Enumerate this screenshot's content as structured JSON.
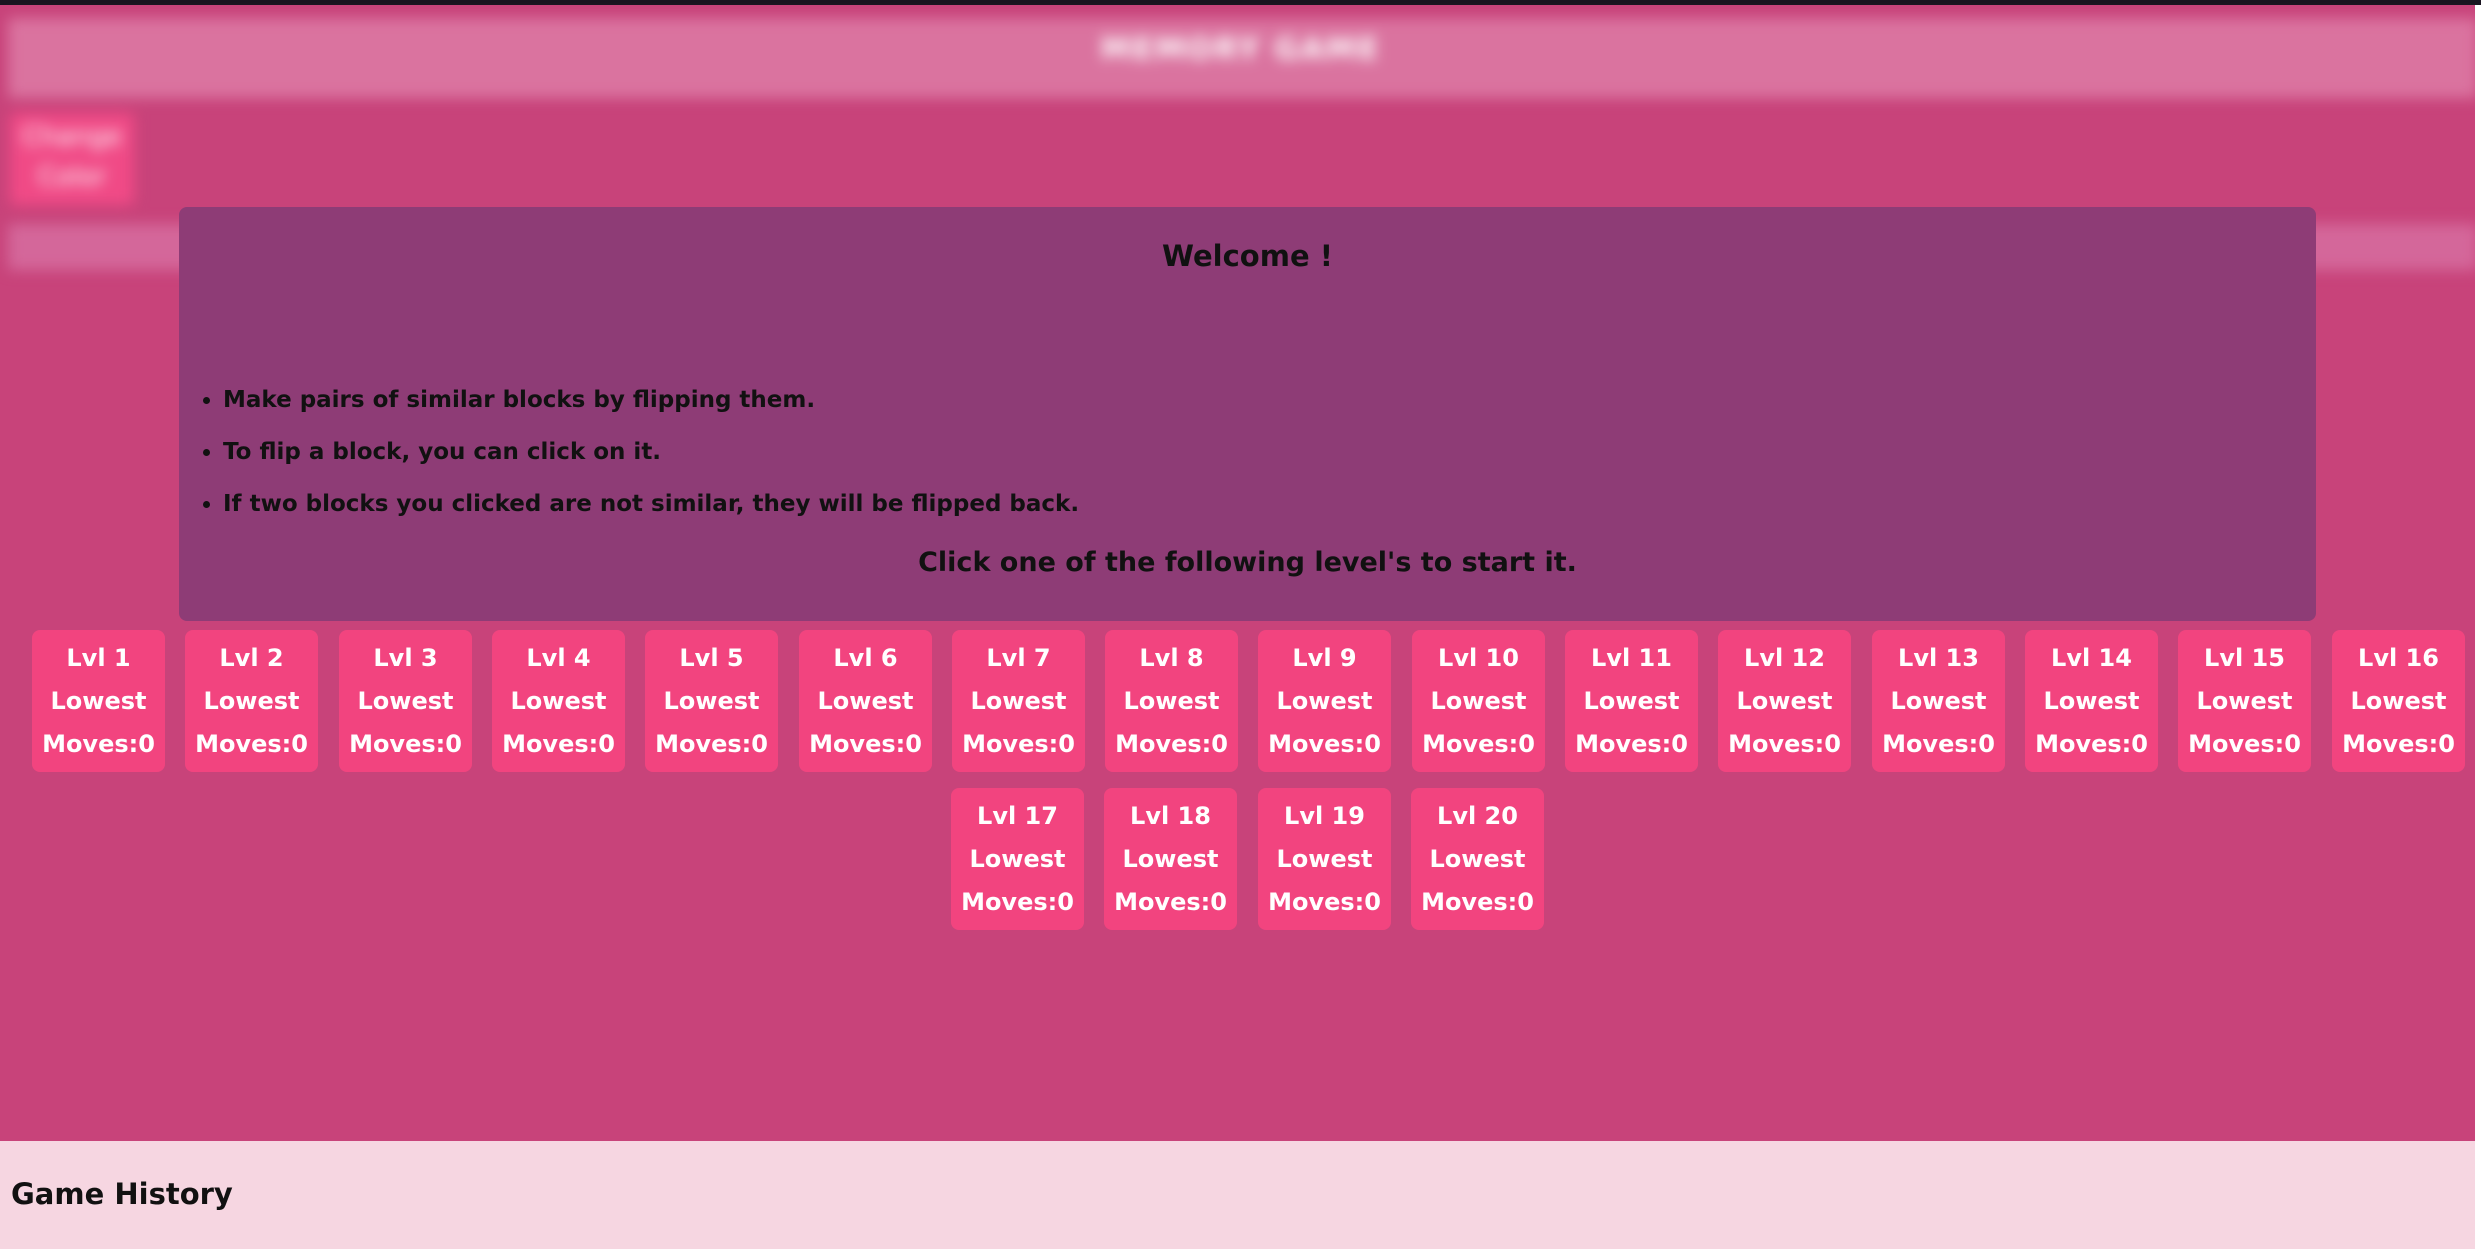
{
  "header": {
    "title": "MEMORY GAME",
    "color_button_label": "Change Color"
  },
  "modal": {
    "title": "Welcome !",
    "instructions": [
      "Make pairs of similar blocks by flipping them.",
      "To flip a block, you can click on it.",
      "If two blocks you clicked are not similar, they will be flipped back."
    ],
    "start_text": "Click one of the following level's to start it."
  },
  "levels": [
    {
      "label": "Lvl 1",
      "lowest": "Lowest",
      "moves": "Moves:0"
    },
    {
      "label": "Lvl 2",
      "lowest": "Lowest",
      "moves": "Moves:0"
    },
    {
      "label": "Lvl 3",
      "lowest": "Lowest",
      "moves": "Moves:0"
    },
    {
      "label": "Lvl 4",
      "lowest": "Lowest",
      "moves": "Moves:0"
    },
    {
      "label": "Lvl 5",
      "lowest": "Lowest",
      "moves": "Moves:0"
    },
    {
      "label": "Lvl 6",
      "lowest": "Lowest",
      "moves": "Moves:0"
    },
    {
      "label": "Lvl 7",
      "lowest": "Lowest",
      "moves": "Moves:0"
    },
    {
      "label": "Lvl 8",
      "lowest": "Lowest",
      "moves": "Moves:0"
    },
    {
      "label": "Lvl 9",
      "lowest": "Lowest",
      "moves": "Moves:0"
    },
    {
      "label": "Lvl 10",
      "lowest": "Lowest",
      "moves": "Moves:0"
    },
    {
      "label": "Lvl 11",
      "lowest": "Lowest",
      "moves": "Moves:0"
    },
    {
      "label": "Lvl 12",
      "lowest": "Lowest",
      "moves": "Moves:0"
    },
    {
      "label": "Lvl 13",
      "lowest": "Lowest",
      "moves": "Moves:0"
    },
    {
      "label": "Lvl 14",
      "lowest": "Lowest",
      "moves": "Moves:0"
    },
    {
      "label": "Lvl 15",
      "lowest": "Lowest",
      "moves": "Moves:0"
    },
    {
      "label": "Lvl 16",
      "lowest": "Lowest",
      "moves": "Moves:0"
    },
    {
      "label": "Lvl 17",
      "lowest": "Lowest",
      "moves": "Moves:0"
    },
    {
      "label": "Lvl 18",
      "lowest": "Lowest",
      "moves": "Moves:0"
    },
    {
      "label": "Lvl 19",
      "lowest": "Lowest",
      "moves": "Moves:0"
    },
    {
      "label": "Lvl 20",
      "lowest": "Lowest",
      "moves": "Moves:0"
    }
  ],
  "footer": {
    "title": "Game History"
  },
  "colors": {
    "page_background": "#c8437a",
    "modal_background": "#8e3c76",
    "level_card": "#f2447f",
    "footer_background": "#f6d6e1"
  }
}
